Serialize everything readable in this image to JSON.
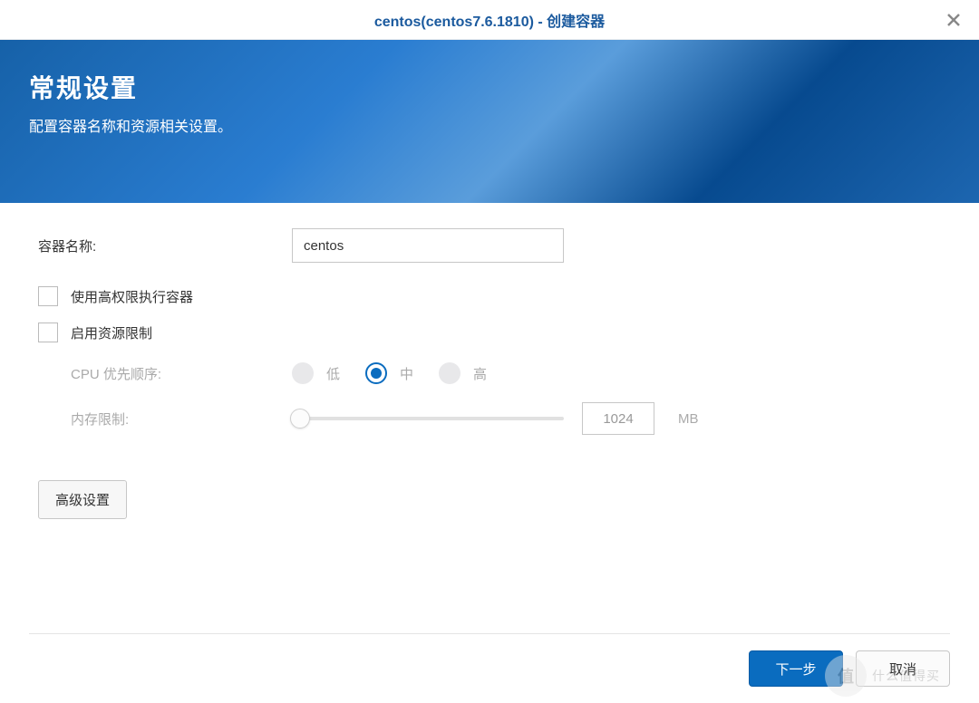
{
  "titlebar": {
    "title": "centos(centos7.6.1810) - 创建容器"
  },
  "banner": {
    "title": "常规设置",
    "subtitle": "配置容器名称和资源相关设置。"
  },
  "form": {
    "container_name_label": "容器名称:",
    "container_name_value": "centos",
    "high_priv_label": "使用高权限执行容器",
    "resource_limit_label": "启用资源限制",
    "cpu_priority_label": "CPU 优先顺序:",
    "cpu_options": {
      "low": "低",
      "mid": "中",
      "high": "高"
    },
    "mem_limit_label": "内存限制:",
    "mem_value": "1024",
    "mem_unit": "MB",
    "advanced_btn": "高级设置"
  },
  "footer": {
    "next": "下一步",
    "cancel": "取消"
  },
  "watermark": {
    "mark": "值",
    "text": "什么值得买"
  }
}
